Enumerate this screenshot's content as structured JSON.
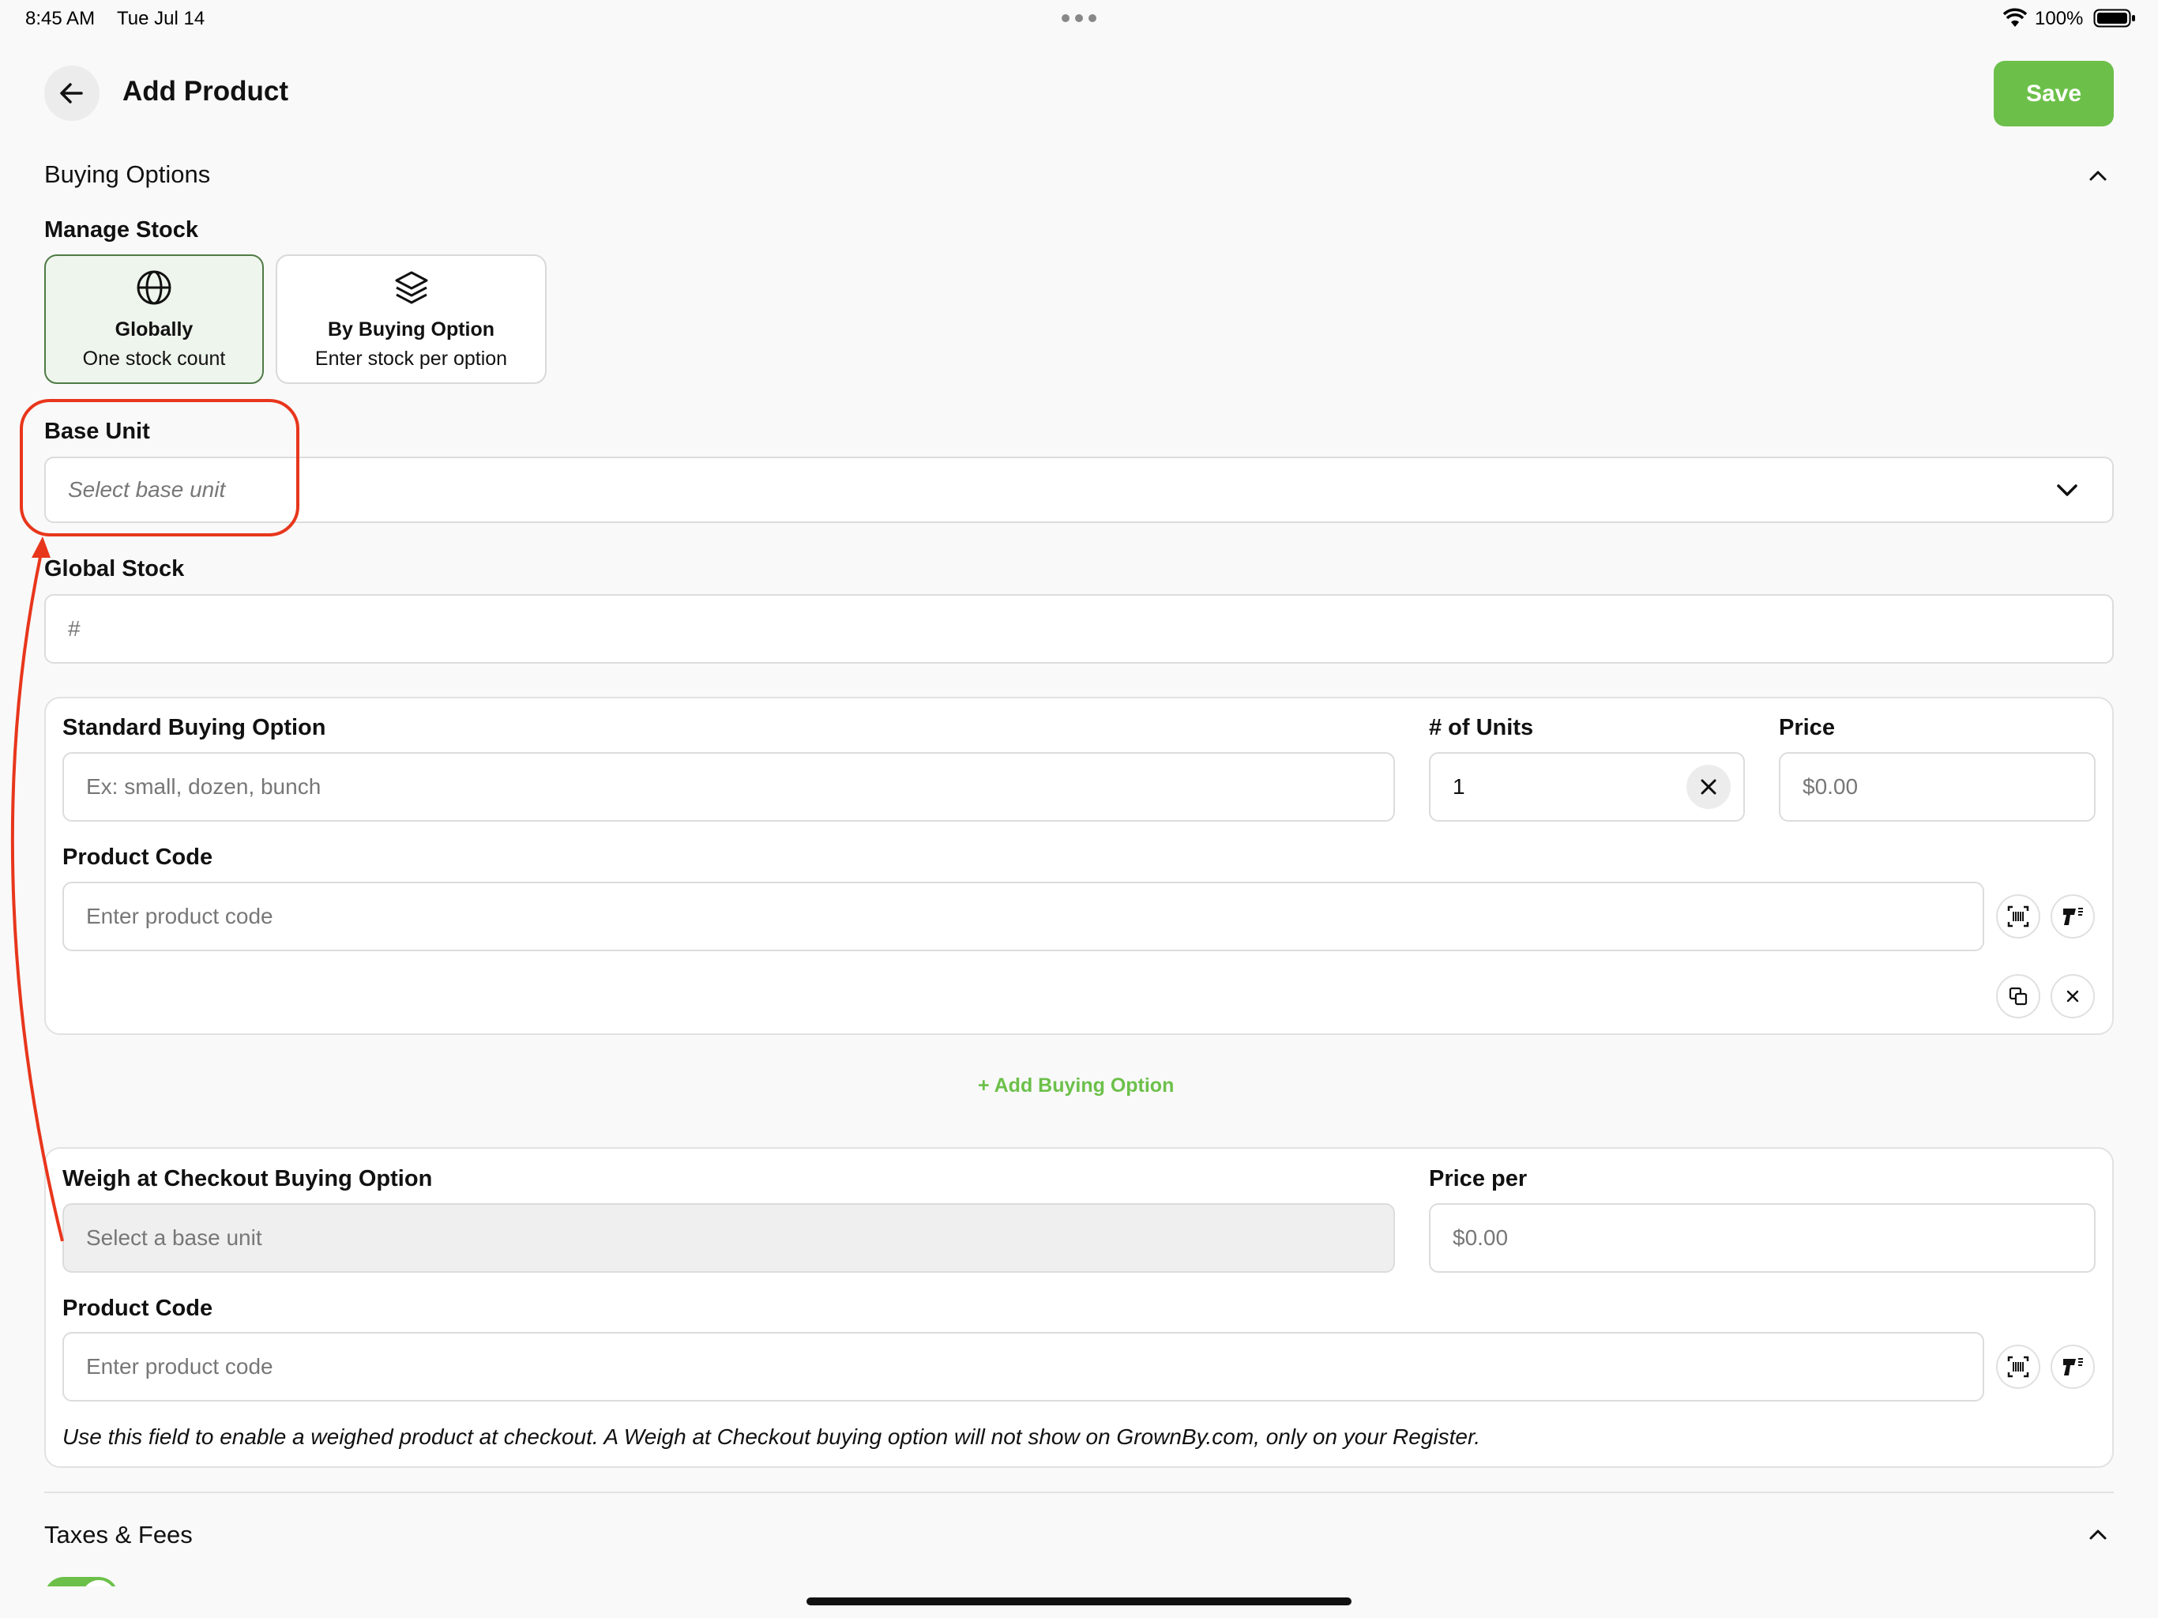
{
  "status_bar": {
    "time": "8:45 AM",
    "date": "Tue Jul 14",
    "battery": "100%"
  },
  "header": {
    "title": "Add Product",
    "save_label": "Save"
  },
  "buying_options": {
    "section_title": "Buying Options",
    "manage_stock_label": "Manage Stock",
    "options": [
      {
        "title": "Globally",
        "subtitle": "One stock count",
        "icon": "globe-icon",
        "selected": true
      },
      {
        "title": "By Buying Option",
        "subtitle": "Enter stock per option",
        "icon": "layers-icon",
        "selected": false
      }
    ],
    "base_unit": {
      "label": "Base Unit",
      "placeholder": "Select base unit"
    },
    "global_stock": {
      "label": "Global Stock",
      "placeholder": "#"
    },
    "standard_option": {
      "label": "Standard Buying Option",
      "name_placeholder": "Ex: small, dozen, bunch",
      "units_label": "# of Units",
      "units_value": "1",
      "price_label": "Price",
      "price_placeholder": "$0.00",
      "product_code_label": "Product Code",
      "product_code_placeholder": "Enter product code"
    },
    "add_buying_option": "+ Add Buying Option",
    "weigh_option": {
      "label": "Weigh at Checkout Buying Option",
      "select_placeholder": "Select a base unit",
      "price_per_label": "Price per",
      "price_per_placeholder": "$0.00",
      "product_code_label": "Product Code",
      "product_code_placeholder": "Enter product code",
      "note": "Use this field to enable a weighed product at checkout. A Weigh at Checkout buying option will not show on GrownBy.com, only on your Register."
    }
  },
  "taxes_fees": {
    "section_title": "Taxes & Fees"
  },
  "colors": {
    "accent": "#6cc04a",
    "annotation": "#e8361c",
    "selected_bg": "#eef5ec"
  }
}
